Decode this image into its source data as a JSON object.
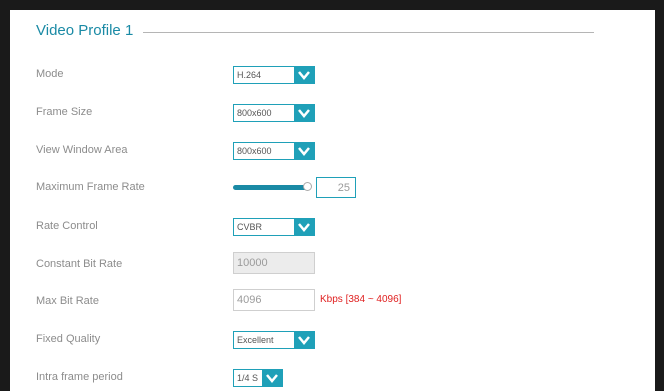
{
  "section": {
    "title": "Video Profile 1"
  },
  "rows": {
    "mode": {
      "label": "Mode",
      "value": "H.264"
    },
    "frame_size": {
      "label": "Frame Size",
      "value": "800x600"
    },
    "view_window": {
      "label": "View Window Area",
      "value": "800x600"
    },
    "max_frame_rate": {
      "label": "Maximum Frame Rate",
      "value": "25",
      "slider_level": 1.0
    },
    "rate_control": {
      "label": "Rate Control",
      "value": "CVBR"
    },
    "constant_bit_rate": {
      "label": "Constant Bit Rate",
      "value": "10000"
    },
    "max_bit_rate": {
      "label": "Max Bit Rate",
      "value": "4096",
      "hint": "Kbps [384 ~ 4096]"
    },
    "fixed_quality": {
      "label": "Fixed Quality",
      "value": "Excellent"
    },
    "intra_frame": {
      "label": "Intra frame period",
      "value": "1/4 S"
    }
  },
  "colors": {
    "accent": "#1fa0b8",
    "title": "#1a8aa5",
    "hint": "#e02020"
  },
  "icons": {
    "dropdown": "chevron-down-icon"
  }
}
